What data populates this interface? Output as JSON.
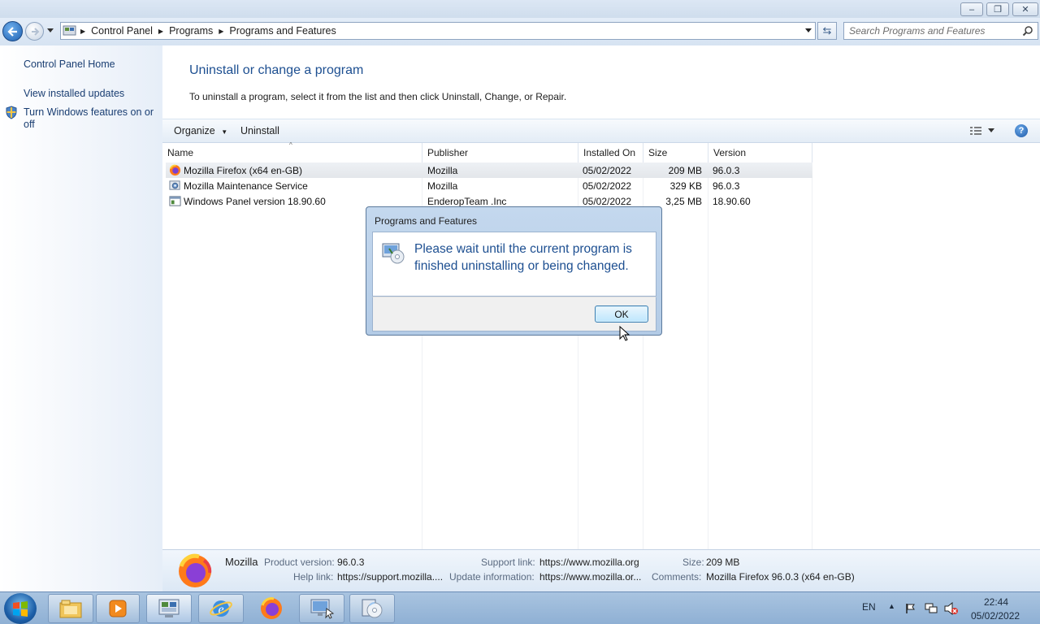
{
  "window": {
    "minimize": "–",
    "maximize": "❐",
    "close": "✕"
  },
  "address": {
    "breadcrumbs": [
      "Control Panel",
      "Programs",
      "Programs and Features"
    ],
    "search_placeholder": "Search Programs and Features"
  },
  "sidebar": {
    "home": "Control Panel Home",
    "updates": "View installed updates",
    "features": "Turn Windows features on or off"
  },
  "main": {
    "heading": "Uninstall or change a program",
    "description": "To uninstall a program, select it from the list and then click Uninstall, Change, or Repair."
  },
  "toolbar": {
    "organize": "Organize",
    "uninstall": "Uninstall"
  },
  "table": {
    "columns": [
      "Name",
      "Publisher",
      "Installed On",
      "Size",
      "Version"
    ],
    "rows": [
      {
        "name": "Mozilla Firefox (x64 en-GB)",
        "publisher": "Mozilla",
        "installed": "05/02/2022",
        "size": "209 MB",
        "version": "96.0.3",
        "icon": "firefox-icon"
      },
      {
        "name": "Mozilla Maintenance Service",
        "publisher": "Mozilla",
        "installed": "05/02/2022",
        "size": "329 KB",
        "version": "96.0.3",
        "icon": "maintenance-service-icon"
      },
      {
        "name": "Windows Panel version 18.90.60",
        "publisher": "EnderopTeam .Inc",
        "installed": "05/02/2022",
        "size": "3,25 MB",
        "version": "18.90.60",
        "icon": "program-icon"
      }
    ]
  },
  "details": {
    "publisher": "Mozilla",
    "product_version_label": "Product version:",
    "product_version": "96.0.3",
    "help_link_label": "Help link:",
    "help_link": "https://support.mozilla....",
    "support_link_label": "Support link:",
    "support_link": "https://www.mozilla.org",
    "update_info_label": "Update information:",
    "update_info": "https://www.mozilla.or...",
    "size_label": "Size:",
    "size": "209 MB",
    "comments_label": "Comments:",
    "comments": "Mozilla Firefox 96.0.3 (x64 en-GB)"
  },
  "dialog": {
    "title": "Programs and Features",
    "message": "Please wait until the current program is finished uninstalling or being changed.",
    "ok": "OK"
  },
  "taskbar": {
    "language": "EN",
    "time": "22:44",
    "date": "05/02/2022",
    "apps": [
      "explorer-icon",
      "media-player-icon",
      "control-panel-icon",
      "internet-explorer-icon",
      "firefox-icon",
      "remote-desktop-icon",
      "disc-setup-icon"
    ]
  },
  "colors": {
    "accent": "#1d4f91",
    "link": "#1a3e72",
    "taskbar": "#9cb8d8"
  }
}
